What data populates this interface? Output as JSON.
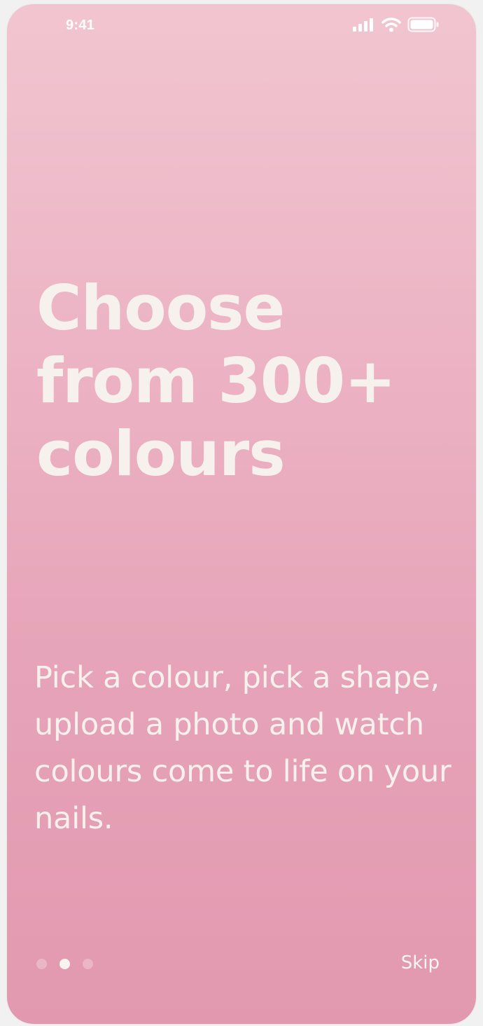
{
  "status_bar": {
    "time": "9:41",
    "icons": [
      "cellular-signal-icon",
      "wifi-icon",
      "battery-icon"
    ]
  },
  "onboarding": {
    "title_lines": [
      "Choose",
      "from 300+",
      "colours"
    ],
    "description": "Pick a colour, pick a shape, upload a photo and watch colours come to life on your nails.",
    "pager": {
      "total_pages": 3,
      "active_page": 2
    },
    "skip_label": "Skip"
  },
  "colors": {
    "gradient_top": "#f1c5d0",
    "gradient_bottom": "#e299b0",
    "text": "#f7f1ee"
  }
}
